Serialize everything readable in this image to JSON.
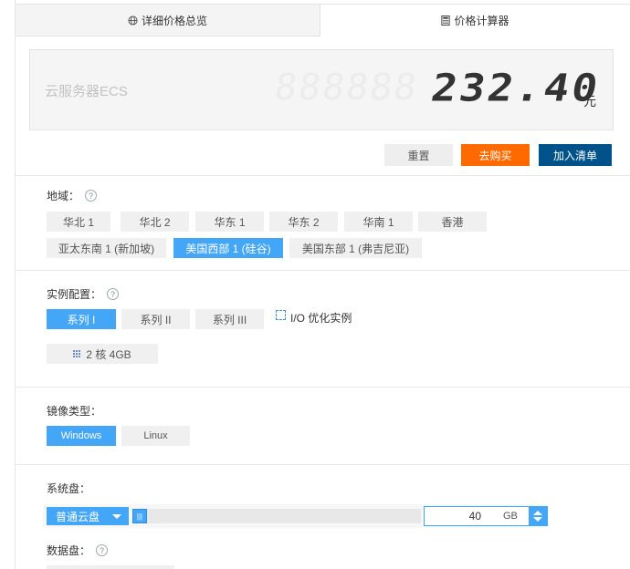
{
  "tabs": {
    "overview_label": "详细价格总览",
    "calculator_label": "价格计算器"
  },
  "price": {
    "product_name": "云服务器ECS",
    "segment_background": "888888",
    "value": "232.40",
    "unit": "元"
  },
  "actions": {
    "reset_label": "重置",
    "buy_label": "去购买",
    "cart_label": "加入清单"
  },
  "region": {
    "label": "地域：",
    "options": [
      "华北 1",
      "华北 2",
      "华东 1",
      "华东 2",
      "华南 1",
      "香港",
      "亚太东南 1 (新加坡)",
      "美国西部 1 (硅谷)",
      "美国东部 1 (弗吉尼亚)"
    ],
    "selected": "美国西部 1 (硅谷)"
  },
  "instance": {
    "label": "实例配置：",
    "series": [
      "系列 I",
      "系列 II",
      "系列 III"
    ],
    "selected_series": "系列 I",
    "io_optimized_label": "I/O 优化实例",
    "io_optimized_checked": false,
    "spec_label": "2 核 4GB"
  },
  "image": {
    "label": "镜像类型：",
    "options": [
      "Windows",
      "Linux"
    ],
    "selected": "Windows"
  },
  "system_disk": {
    "label": "系统盘：",
    "type": "普通云盘",
    "handle_text": "|||",
    "size": "40",
    "unit": "GB",
    "slider_fraction": 0.0
  },
  "data_disk": {
    "label": "数据盘："
  },
  "colors": {
    "accent": "#44a6f6",
    "buy": "#ff6a00",
    "cart": "#00528b"
  }
}
